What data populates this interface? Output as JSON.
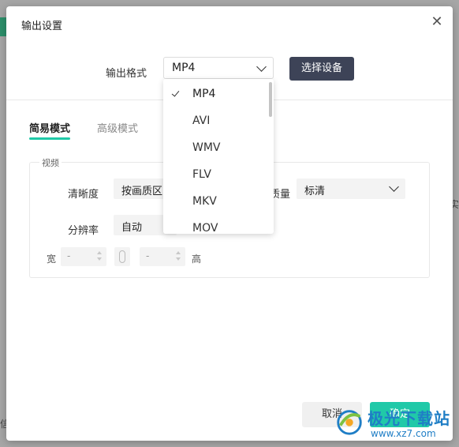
{
  "background": {
    "left_text": "信",
    "right_text": "实"
  },
  "dialog": {
    "title": "输出设置",
    "close_label": "✕"
  },
  "format": {
    "label": "输出格式",
    "selected": "MP4",
    "select_device_label": "选择设备",
    "options": [
      "MP4",
      "AVI",
      "WMV",
      "FLV",
      "MKV",
      "MOV"
    ]
  },
  "tabs": {
    "simple": "简易模式",
    "advanced": "高级模式"
  },
  "video": {
    "legend": "视频",
    "clarity_label": "清晰度",
    "clarity_value": "按画质区",
    "quality_label": "质量",
    "quality_value": "标清",
    "resolution_label": "分辨率",
    "resolution_value": "自动",
    "width_label": "宽",
    "width_value": "-",
    "height_label": "高",
    "height_value": "-"
  },
  "footer": {
    "cancel": "取消",
    "ok": "确定"
  },
  "watermark": {
    "name": "极光下载站",
    "url": "www.xz7.com"
  },
  "colors": {
    "accent": "#20c9a8",
    "device_button": "#3d4357",
    "watermark": "#1f7ec6"
  }
}
